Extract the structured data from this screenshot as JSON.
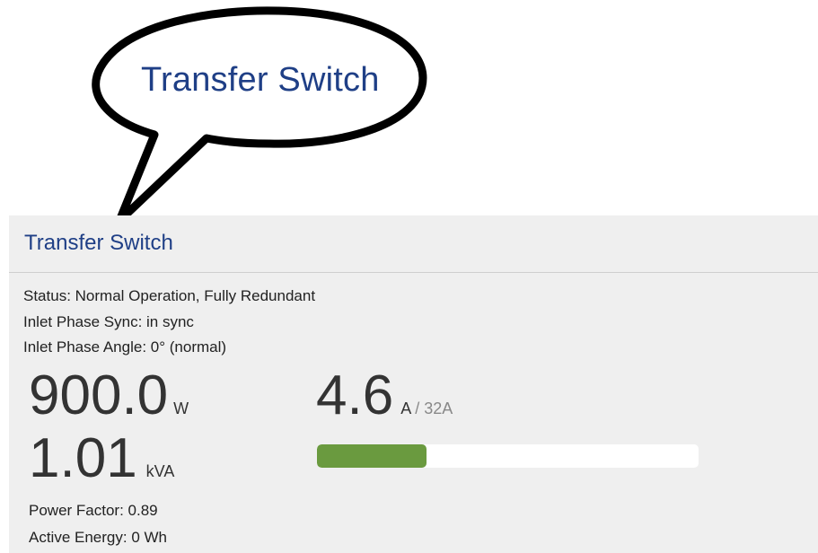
{
  "callout": {
    "text": "Transfer Switch"
  },
  "panel": {
    "title": "Transfer Switch",
    "status": "Status: Normal Operation, Fully Redundant",
    "phase_sync": "Inlet Phase Sync: in sync",
    "phase_angle": "Inlet Phase Angle: 0° (normal)"
  },
  "metrics": {
    "power_value": "900.0",
    "power_unit": "W",
    "apparent_value": "1.01",
    "apparent_unit": "kVA",
    "current_value": "4.6",
    "current_unit": "A",
    "current_max": "/ 32A",
    "current_fraction": 0.287,
    "power_factor": "Power Factor: 0.89",
    "active_energy": "Active Energy: 0 Wh"
  },
  "colors": {
    "title_blue": "#1f3f86",
    "bar_green": "#6a9a3f",
    "panel_bg": "#efefef"
  }
}
